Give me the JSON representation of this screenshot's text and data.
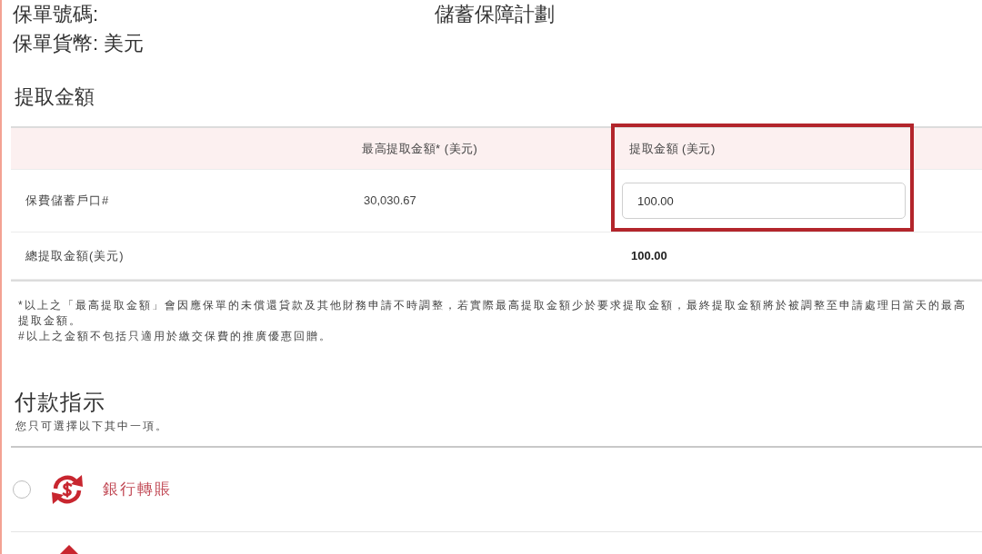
{
  "policy_header": {
    "policy_number_label": "保單號碼:",
    "plan_name": "儲蓄保障計劃",
    "currency": "保單貨幣: 美元"
  },
  "withdrawal": {
    "title": "提取金額",
    "table": {
      "columns": [
        {
          "label": "最高提取金額* (美元)",
          "highlighted": false
        },
        {
          "label": "提取金額 (美元)",
          "highlighted": true
        }
      ],
      "rows": [
        {
          "kind": "input",
          "label": "保費儲蓄戶口#",
          "max_amount": "30,030.67",
          "amount": "100.00"
        },
        {
          "kind": "total",
          "label": "總提取金額(美元)",
          "amount": "100.00"
        }
      ]
    },
    "footnotes": [
      "*以上之「最高提取金額」會因應保單的未償還貸款及其他財務申請不時調整，若實際最高提取金額少於要求提取金額，最終提取金額將於被調整至申請處理日當天的最高提取金額。",
      "#以上之金額不包括只適用於繳交保費的推廣優惠回贈。"
    ]
  },
  "payment_instructions": {
    "title": "付款指示",
    "hint": "您只可選擇以下其中一項。",
    "options": [
      {
        "kind": "bank_transfer",
        "label": "銀行轉賬",
        "selected": false
      },
      {
        "kind": "partial"
      }
    ]
  }
}
